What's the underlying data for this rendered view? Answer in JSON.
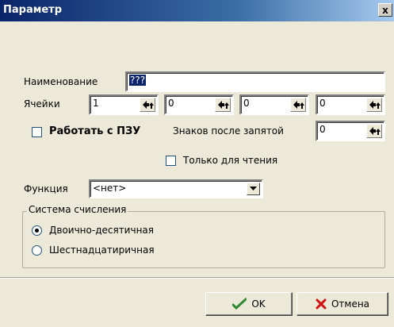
{
  "window": {
    "title": "Параметр",
    "close_glyph": "x"
  },
  "form": {
    "name_label": "Наименование",
    "name_value": "???",
    "cells_label": "Ячейки",
    "cells": [
      "1",
      "0",
      "0",
      "0"
    ],
    "rom_checkbox_label": "Работать с ПЗУ",
    "rom_checked": false,
    "decimals_label": "Знаков после запятой",
    "decimals_value": "0",
    "readonly_label": "Только для чтения",
    "readonly_checked": false,
    "function_label": "Функция",
    "function_value": "<нет>"
  },
  "numeral_system": {
    "legend": "Система счисления",
    "options": [
      {
        "label": "Двоично-десятичная",
        "selected": true
      },
      {
        "label": "Шестнадцатиричная",
        "selected": false
      }
    ]
  },
  "buttons": {
    "ok_label": "OK",
    "cancel_label": "Отмена"
  },
  "colors": {
    "title_gradient_start": "#0a246a",
    "ok_check": "#2e8b2e",
    "cancel_x": "#d01010"
  },
  "icons": {
    "spin": "spin-arrows-icon",
    "ok": "green-check-icon",
    "cancel": "red-x-icon",
    "dropdown": "chevron-down-icon"
  }
}
